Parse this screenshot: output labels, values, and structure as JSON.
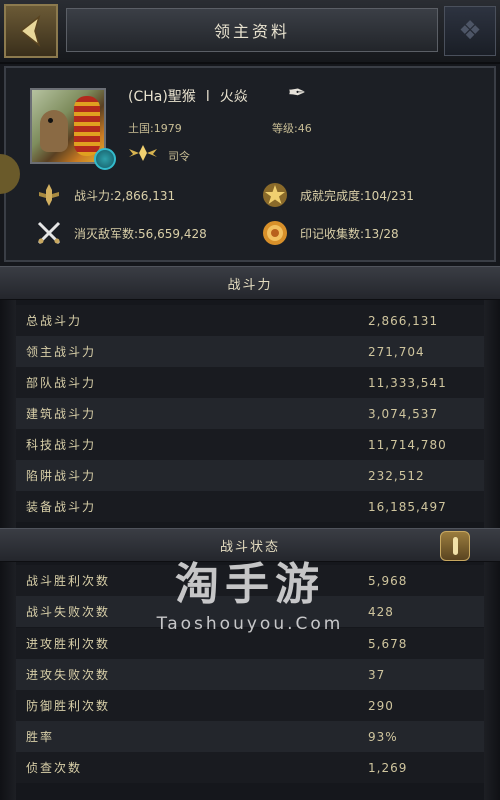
{
  "header": {
    "title": "领主资料"
  },
  "profile": {
    "name": "(CHa)聖猴",
    "level_sep": "l",
    "nickname": "火焱",
    "land_label": "土国:1979",
    "level_label": "等级:46",
    "rank": "司令",
    "stats": {
      "power": "战斗力:2,866,131",
      "achievement": "成就完成度:104/231",
      "kills": "消灭敌军数:56,659,428",
      "seals": "印记收集数:13/28"
    }
  },
  "sections": {
    "power_title": "战斗力",
    "battle_title": "战斗状态"
  },
  "power_rows": [
    {
      "label": "总战斗力",
      "value": "2,866,131"
    },
    {
      "label": "领主战斗力",
      "value": "271,704"
    },
    {
      "label": "部队战斗力",
      "value": "11,333,541"
    },
    {
      "label": "建筑战斗力",
      "value": "3,074,537"
    },
    {
      "label": "科技战斗力",
      "value": "11,714,780"
    },
    {
      "label": "陷阱战斗力",
      "value": "232,512"
    },
    {
      "label": "装备战斗力",
      "value": "16,185,497"
    }
  ],
  "battle_rows": [
    {
      "label": "战斗胜利次数",
      "value": "5,968"
    },
    {
      "label": "战斗失败次数",
      "value": "428"
    },
    {
      "label": "进攻胜利次数",
      "value": "5,678"
    },
    {
      "label": "进攻失败次数",
      "value": "37"
    },
    {
      "label": "防御胜利次数",
      "value": "290"
    },
    {
      "label": "胜率",
      "value": "93%"
    },
    {
      "label": "侦查次数",
      "value": "1,269"
    }
  ],
  "watermark": {
    "logo": "淘手游",
    "url": "Taoshouyou.Com"
  },
  "colors": {
    "gold": "#c8a860",
    "text": "#d9cfa8",
    "bg": "#15171c"
  }
}
